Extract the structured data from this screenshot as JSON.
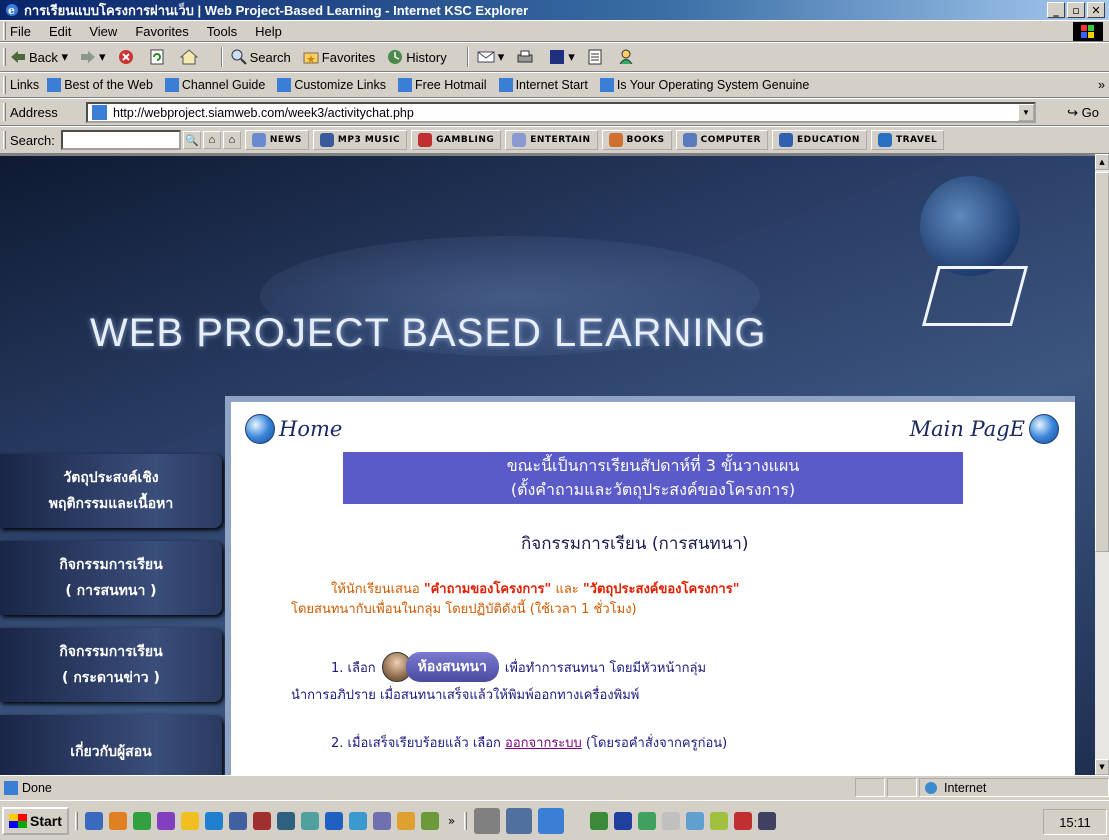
{
  "window": {
    "title": "การเรียนแบบโครงการผ่านเว็บ | Web Project-Based Learning - Internet KSC Explorer"
  },
  "menu": [
    "File",
    "Edit",
    "View",
    "Favorites",
    "Tools",
    "Help"
  ],
  "toolbar": {
    "back": "Back",
    "search": "Search",
    "favorites": "Favorites",
    "history": "History"
  },
  "links": {
    "label": "Links",
    "items": [
      "Best of the Web",
      "Channel Guide",
      "Customize Links",
      "Free Hotmail",
      "Internet Start",
      "Is Your Operating System Genuine"
    ]
  },
  "address": {
    "label": "Address",
    "url": "http://webproject.siamweb.com/week3/activitychat.php",
    "go": "Go"
  },
  "searchbar": {
    "label": "Search:",
    "channels": [
      "NEWS",
      "MP3 MUSIC",
      "GAMBLING",
      "ENTERTAIN",
      "BOOKS",
      "COMPUTER",
      "EDUCATION",
      "TRAVEL"
    ]
  },
  "page": {
    "banner": "WEB PROJECT BASED LEARNING",
    "home": "Home",
    "main_page": "Main PagE",
    "week_line1": "ขณะนี้เป็นการเรียนสัปดาห์ที่ 3 ขั้นวางแผน",
    "week_line2": "(ตั้งคำถามและวัตถุประสงค์ของโครงการ)",
    "activity_title": "กิจกรรมการเรียน (การสนทนา)",
    "instr_a": "ให้นักเรียนเสนอ ",
    "instr_b": "\"คำถามของโครงการ\"",
    "instr_c": " และ ",
    "instr_d": "\"วัตถุประสงค์ของโครงการ\"",
    "instr_line2": "โดยสนทนากับเพื่อนในกลุ่ม โดยปฏิบัติดังนี้ (ใช้เวลา 1 ชั่วโมง)",
    "step1_a": "1. เลือก",
    "chat_button": "ห้องสนทนา",
    "step1_b": "เพื่อทำการสนทนา โดยมีหัวหน้ากลุ่ม",
    "step1_line2": "นำการอภิปราย เมื่อสนทนาเสร็จแล้วให้พิมพ์ออกทางเครื่องพิมพ์",
    "step2_a": "2. เมื่อเสร็จเรียบร้อยแล้ว เลือก ",
    "step2_link": "ออกจากระบบ",
    "step2_b": " (โดยรอคำสั่งจากครูก่อน)"
  },
  "sidebar": [
    {
      "line1": "วัตถุประสงค์เชิง",
      "line2": "พฤติกรรมและเนื้อหา"
    },
    {
      "line1": "กิจกรรมการเรียน",
      "line2": "( การสนทนา )"
    },
    {
      "line1": "กิจกรรมการเรียน",
      "line2": "( กระดานข่าว )"
    },
    {
      "line1": "เกี่ยวกับผู้สอน",
      "line2": ""
    }
  ],
  "status": {
    "text": "Done",
    "zone": "Internet"
  },
  "taskbar": {
    "start": "Start",
    "time": "15:11"
  }
}
